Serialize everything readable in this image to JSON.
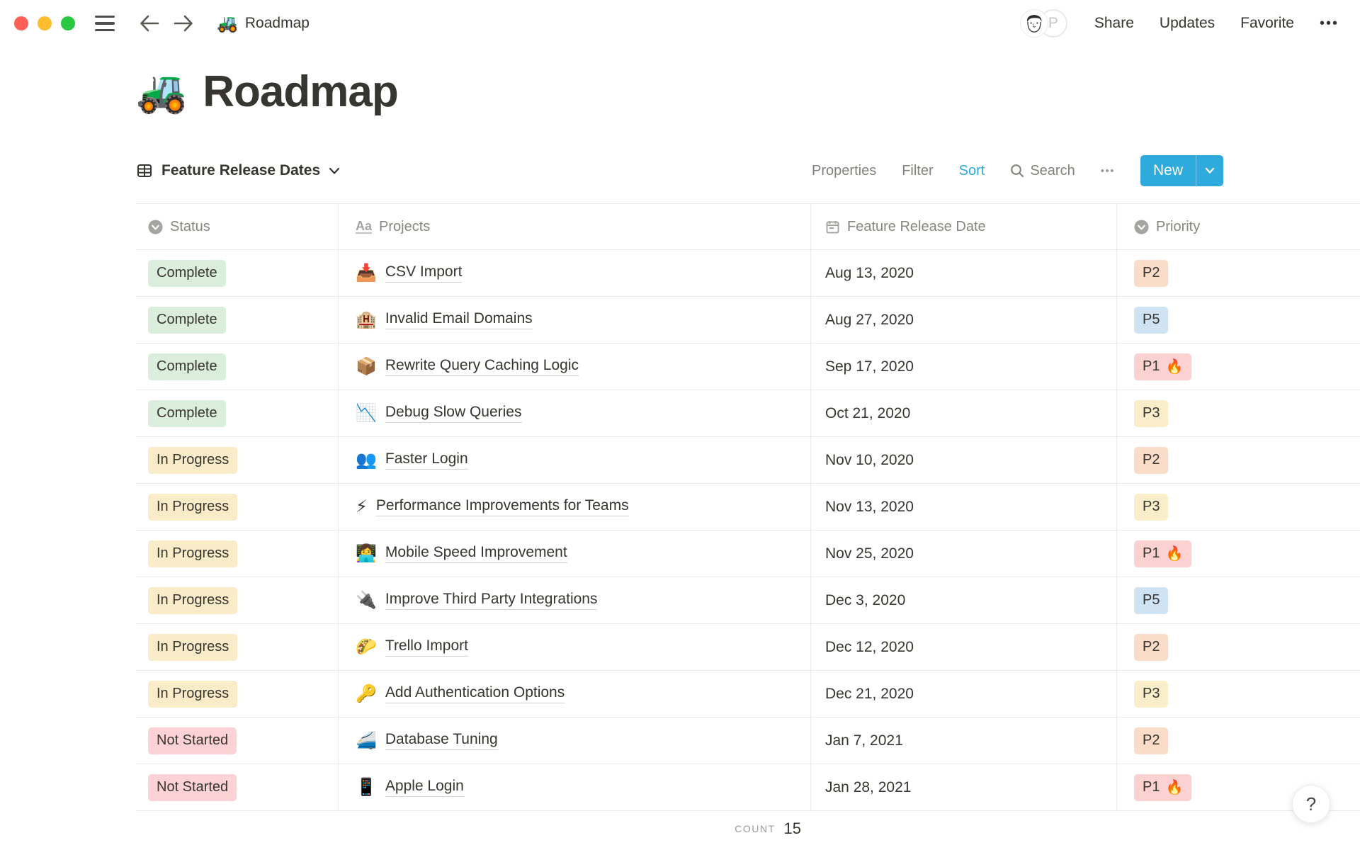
{
  "topbar": {
    "breadcrumb": {
      "icon": "🚜",
      "label": "Roadmap"
    },
    "actions": {
      "share": "Share",
      "updates": "Updates",
      "favorite": "Favorite",
      "more": "•••"
    },
    "avatar_letter": "P"
  },
  "page": {
    "icon": "🚜",
    "title": "Roadmap"
  },
  "view_bar": {
    "view_name": "Feature Release Dates",
    "properties": "Properties",
    "filter": "Filter",
    "sort": "Sort",
    "search": "Search",
    "more": "•••",
    "new_label": "New"
  },
  "table": {
    "columns": [
      {
        "label": "Status",
        "icon": "select-icon"
      },
      {
        "label": "Projects",
        "icon": "title-icon"
      },
      {
        "label": "Feature Release Date",
        "icon": "calendar-icon"
      },
      {
        "label": "Priority",
        "icon": "select-icon"
      }
    ],
    "rows": [
      {
        "status": "Complete",
        "status_color": "green",
        "icon": "📥",
        "icon_name": "inbox-tray-icon",
        "project": "CSV Import",
        "date": "Aug 13, 2020",
        "priority": "P2",
        "priority_color": "orange",
        "flame": false
      },
      {
        "status": "Complete",
        "status_color": "green",
        "icon": "🏨",
        "icon_name": "hotel-icon",
        "project": "Invalid Email Domains",
        "date": "Aug 27, 2020",
        "priority": "P5",
        "priority_color": "blue",
        "flame": false
      },
      {
        "status": "Complete",
        "status_color": "green",
        "icon": "📦",
        "icon_name": "package-icon",
        "project": "Rewrite Query Caching Logic",
        "date": "Sep 17, 2020",
        "priority": "P1",
        "priority_color": "red",
        "flame": true
      },
      {
        "status": "Complete",
        "status_color": "green",
        "icon": "📉",
        "icon_name": "chart-decreasing-icon",
        "project": "Debug Slow Queries",
        "date": "Oct 21, 2020",
        "priority": "P3",
        "priority_color": "yellow",
        "flame": false
      },
      {
        "status": "In Progress",
        "status_color": "yellow",
        "icon": "👥",
        "icon_name": "busts-in-silhouette-icon",
        "project": "Faster Login",
        "date": "Nov 10, 2020",
        "priority": "P2",
        "priority_color": "orange",
        "flame": false
      },
      {
        "status": "In Progress",
        "status_color": "yellow",
        "icon": "⚡",
        "icon_name": "high-voltage-icon",
        "project": "Performance Improvements for Teams",
        "date": "Nov 13, 2020",
        "priority": "P3",
        "priority_color": "yellow",
        "flame": false
      },
      {
        "status": "In Progress",
        "status_color": "yellow",
        "icon": "👩‍💻",
        "icon_name": "technologist-icon",
        "project": "Mobile Speed Improvement",
        "date": "Nov 25, 2020",
        "priority": "P1",
        "priority_color": "red",
        "flame": true
      },
      {
        "status": "In Progress",
        "status_color": "yellow",
        "icon": "🔌",
        "icon_name": "electric-plug-icon",
        "project": "Improve Third Party Integrations",
        "date": "Dec 3, 2020",
        "priority": "P5",
        "priority_color": "blue",
        "flame": false
      },
      {
        "status": "In Progress",
        "status_color": "yellow",
        "icon": "🌮",
        "icon_name": "taco-icon",
        "project": "Trello Import",
        "date": "Dec 12, 2020",
        "priority": "P2",
        "priority_color": "orange",
        "flame": false
      },
      {
        "status": "In Progress",
        "status_color": "yellow",
        "icon": "🔑",
        "icon_name": "key-icon",
        "project": "Add Authentication Options",
        "date": "Dec 21, 2020",
        "priority": "P3",
        "priority_color": "yellow",
        "flame": false
      },
      {
        "status": "Not Started",
        "status_color": "red",
        "icon": "🚄",
        "icon_name": "high-speed-train-icon",
        "project": "Database Tuning",
        "date": "Jan 7, 2021",
        "priority": "P2",
        "priority_color": "orange",
        "flame": false
      },
      {
        "status": "Not Started",
        "status_color": "red",
        "icon": "📱",
        "icon_name": "mobile-phone-icon",
        "project": "Apple Login",
        "date": "Jan 28, 2021",
        "priority": "P1",
        "priority_color": "red",
        "flame": true
      }
    ],
    "footer": {
      "count_label": "COUNT",
      "count_value": "15"
    }
  },
  "help_label": "?",
  "flame_icon": "🔥",
  "colors": {
    "accent": "#2eaadc",
    "status_palette": {
      "green": "#dbeddb",
      "yellow": "#fbecc9",
      "red": "#fdd2d6"
    },
    "priority_palette": {
      "red": "#fbd1d2",
      "orange": "#fadcc9",
      "yellow": "#faedca",
      "blue": "#cfe3f4"
    }
  }
}
